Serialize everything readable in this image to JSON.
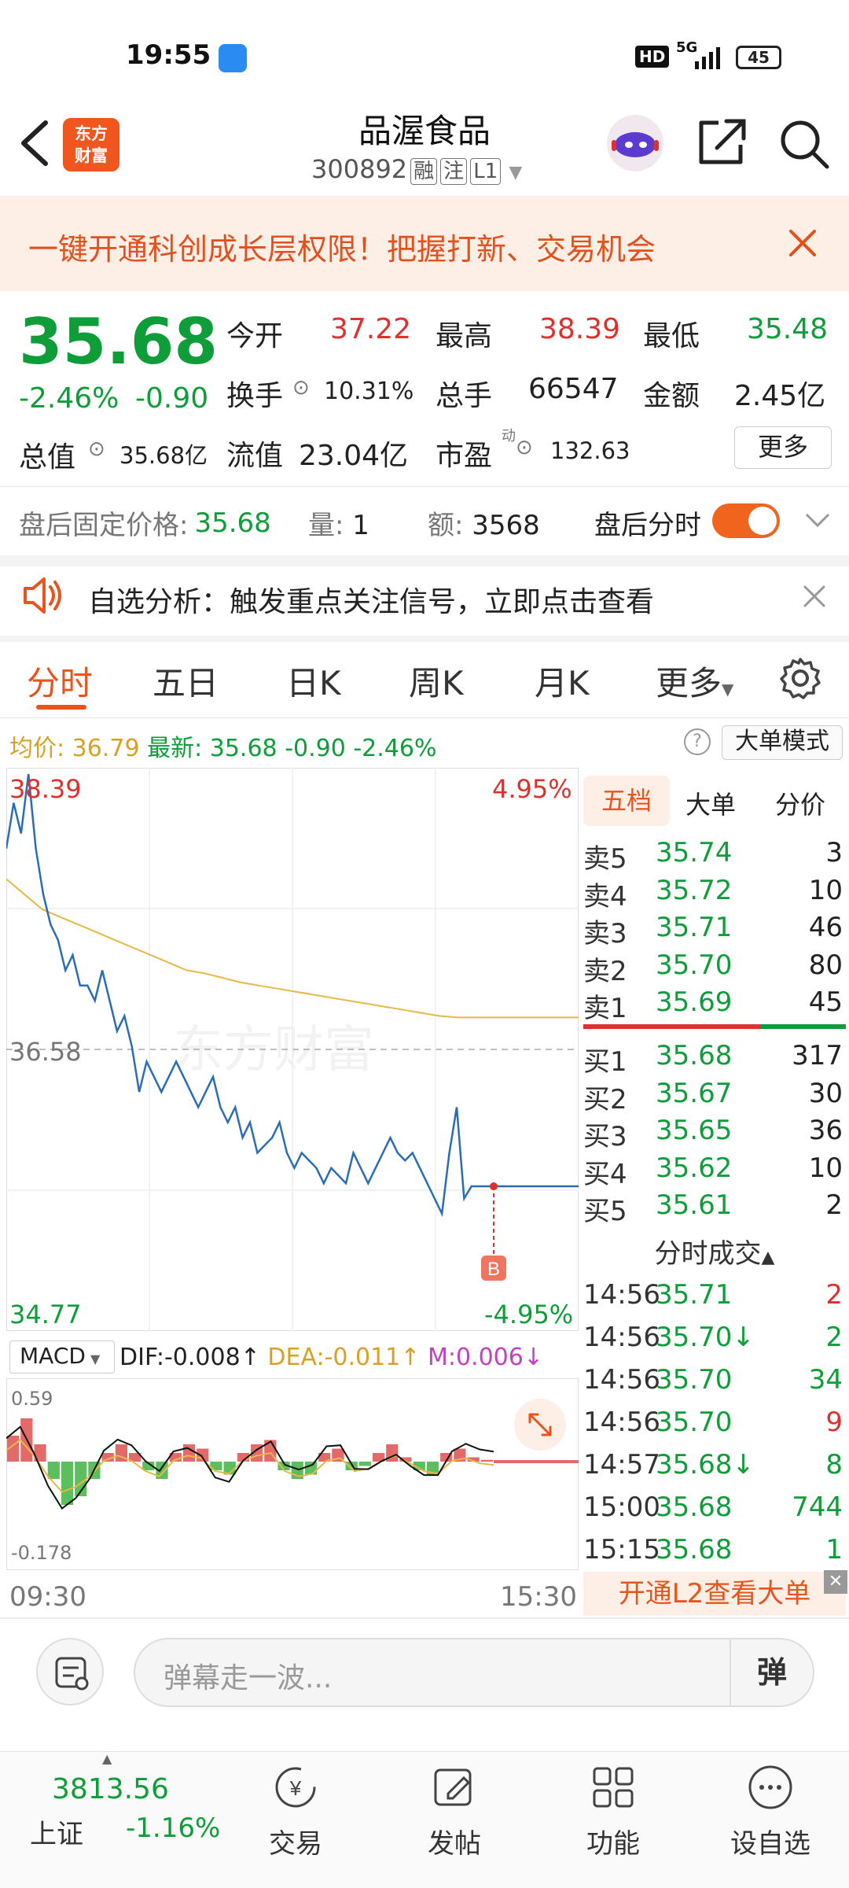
{
  "status_bar": {
    "time": "19:55",
    "network": "5G",
    "hd": "HD",
    "battery": "45"
  },
  "header": {
    "logo_line1": "东方",
    "logo_line2": "财富",
    "title": "品渥食品",
    "code": "300892",
    "tags": [
      "融",
      "注",
      "L1"
    ]
  },
  "banner": {
    "text": "一键开通科创成长层权限！把握打新、交易机会"
  },
  "quote": {
    "price": "35.68",
    "change_pct": "-2.46%",
    "change": "-0.90",
    "open_label": "今开",
    "open": "37.22",
    "high_label": "最高",
    "high": "38.39",
    "low_label": "最低",
    "low": "35.48",
    "turnover_label": "换手",
    "turnover": "10.31%",
    "volume_label": "总手",
    "volume": "66547",
    "amount_label": "金额",
    "amount": "2.45亿",
    "mcap_label": "总值",
    "mcap": "35.68亿",
    "float_label": "流值",
    "float": "23.04亿",
    "pe_label": "市盈",
    "pe_sup": "动",
    "pe": "132.63",
    "more_label": "更多"
  },
  "after_hours": {
    "price_label": "盘后固定价格:",
    "price": "35.68",
    "vol_label": "量:",
    "vol": "1",
    "amt_label": "额:",
    "amt": "3568",
    "timeshare_label": "盘后分时",
    "toggle_on": true
  },
  "notice": {
    "text": "自选分析：触发重点关注信号，立即点击查看"
  },
  "tabs": [
    "分时",
    "五日",
    "日K",
    "周K",
    "月K",
    "更多"
  ],
  "active_tab": "分时",
  "chart_info": {
    "avg_label": "均价:",
    "avg": "36.79",
    "latest_label": "最新:",
    "latest": "35.68",
    "latest_chg": "-0.90",
    "latest_pct": "-2.46%",
    "big_mode": "大单模式"
  },
  "chart_data": {
    "type": "line",
    "x_start": "09:30",
    "x_end": "15:30",
    "y_max": "38.39",
    "y_max_pct": "4.95%",
    "y_min": "34.77",
    "y_min_pct": "-4.95%",
    "y_ref": "36.58",
    "marker": "B",
    "price_series": [
      37.9,
      38.2,
      38.0,
      38.39,
      37.9,
      37.6,
      37.4,
      37.3,
      37.1,
      37.2,
      37.0,
      37.0,
      36.9,
      37.1,
      36.9,
      36.7,
      36.8,
      36.6,
      36.3,
      36.5,
      36.4,
      36.3,
      36.4,
      36.5,
      36.4,
      36.3,
      36.2,
      36.3,
      36.4,
      36.2,
      36.1,
      36.2,
      36.0,
      36.1,
      35.9,
      35.95,
      36.0,
      36.1,
      35.9,
      35.8,
      35.9,
      35.85,
      35.8,
      35.7,
      35.8,
      35.75,
      35.7,
      35.9,
      35.8,
      35.7,
      35.8,
      35.9,
      36.0,
      35.9,
      35.85,
      35.9,
      35.8,
      35.7,
      35.6,
      35.5,
      35.9,
      36.2,
      35.6,
      35.68,
      35.68,
      35.68,
      35.68
    ],
    "avg_series": [
      37.7,
      37.6,
      37.5,
      37.45,
      37.4,
      37.35,
      37.3,
      37.25,
      37.2,
      37.15,
      37.1,
      37.08,
      37.05,
      37.02,
      37.0,
      36.98,
      36.96,
      36.94,
      36.92,
      36.9,
      36.88,
      36.86,
      36.84,
      36.82,
      36.8,
      36.79,
      36.79,
      36.79
    ],
    "macd": {
      "dif_label": "DIF:",
      "dif": "-0.008",
      "dea_label": "DEA:",
      "dea": "-0.011",
      "m_label": "M:",
      "m": "0.006",
      "top": "0.59",
      "bottom": "-0.178",
      "hist": [
        0.3,
        0.5,
        0.2,
        -0.2,
        -0.5,
        -0.4,
        -0.2,
        0.1,
        0.2,
        0.1,
        -0.1,
        -0.2,
        0.1,
        0.2,
        0.15,
        -0.1,
        -0.15,
        0.1,
        0.2,
        0.25,
        -0.1,
        -0.2,
        -0.15,
        0.1,
        0.15,
        -0.1,
        -0.05,
        0.1,
        0.2,
        0.05,
        -0.1,
        -0.15,
        0.1,
        0.15,
        0.05,
        0.02
      ]
    }
  },
  "order_book": {
    "tabs": [
      "五档",
      "大单",
      "分价"
    ],
    "asks": [
      {
        "label": "卖5",
        "price": "35.74",
        "vol": "3"
      },
      {
        "label": "卖4",
        "price": "35.72",
        "vol": "10"
      },
      {
        "label": "卖3",
        "price": "35.71",
        "vol": "46"
      },
      {
        "label": "卖2",
        "price": "35.70",
        "vol": "80"
      },
      {
        "label": "卖1",
        "price": "35.69",
        "vol": "45"
      }
    ],
    "bids": [
      {
        "label": "买1",
        "price": "35.68",
        "vol": "317"
      },
      {
        "label": "买2",
        "price": "35.67",
        "vol": "30"
      },
      {
        "label": "买3",
        "price": "35.65",
        "vol": "36"
      },
      {
        "label": "买4",
        "price": "35.62",
        "vol": "10"
      },
      {
        "label": "买5",
        "price": "35.61",
        "vol": "2"
      }
    ],
    "trades_title": "分时成交",
    "trades": [
      {
        "time": "14:56",
        "price": "35.71",
        "vol": "2",
        "color": "red"
      },
      {
        "time": "14:56",
        "price": "35.70↓",
        "vol": "2",
        "color": "green"
      },
      {
        "time": "14:56",
        "price": "35.70",
        "vol": "34",
        "color": "green"
      },
      {
        "time": "14:56",
        "price": "35.70",
        "vol": "9",
        "color": "red"
      },
      {
        "time": "14:57",
        "price": "35.68↓",
        "vol": "8",
        "color": "green"
      },
      {
        "time": "15:00",
        "price": "35.68",
        "vol": "744",
        "color": "green"
      },
      {
        "time": "15:15",
        "price": "35.68",
        "vol": "1",
        "color": "green"
      }
    ],
    "l2_promo": "开通L2查看大单"
  },
  "comment": {
    "placeholder": "弹幕走一波...",
    "send": "弹"
  },
  "bottom_nav": {
    "index_value": "3813.56",
    "index_name": "上证",
    "index_pct": "-1.16%",
    "items": [
      "交易",
      "发帖",
      "功能",
      "设自选"
    ]
  }
}
